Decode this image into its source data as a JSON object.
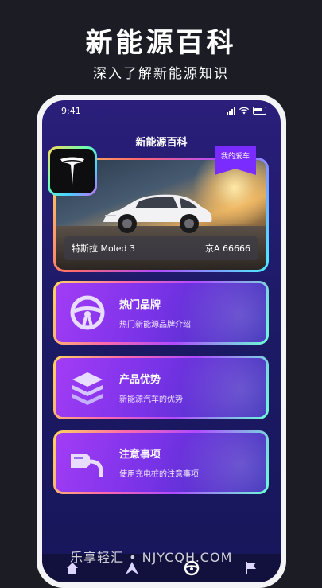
{
  "promo": {
    "title": "新能源百科",
    "subtitle": "深入了解新能源知识"
  },
  "status_bar": {
    "time": "9:41"
  },
  "screen": {
    "title": "新能源百科"
  },
  "car_card": {
    "tag": "我的爱车",
    "brand_model": "特斯拉  Moled 3",
    "plate": "京A 66666",
    "logo_icon": "tesla-logo-icon"
  },
  "menu": [
    {
      "title": "热门品牌",
      "subtitle": "热门新能源品牌介绍",
      "icon": "steering-wheel-icon"
    },
    {
      "title": "产品优势",
      "subtitle": "新能源汽车的优势",
      "icon": "layers-icon"
    },
    {
      "title": "注意事项",
      "subtitle": "使用充电桩的注意事项",
      "icon": "charger-plug-icon"
    }
  ],
  "tabbar": {
    "icons": [
      "home-icon",
      "discover-icon",
      "steering-wheel-icon",
      "flag-icon"
    ]
  },
  "watermark": "乐享轻汇 • NJYCQH.COM",
  "colors": {
    "accent_purple": "#7a2cff",
    "background": "#1b1c24"
  }
}
